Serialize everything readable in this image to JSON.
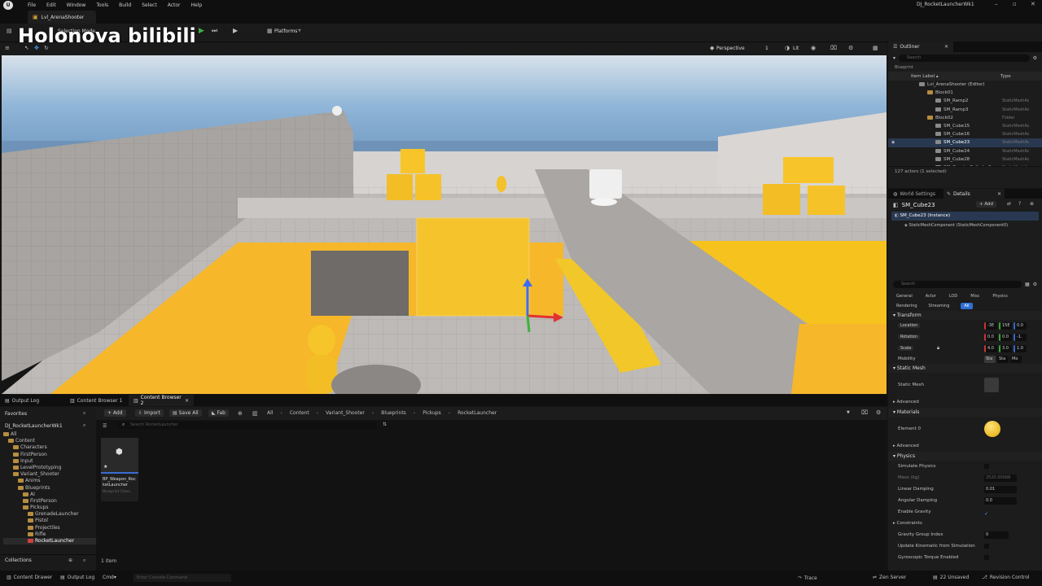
{
  "menu": {
    "items": [
      "File",
      "Edit",
      "Window",
      "Tools",
      "Build",
      "Select",
      "Actor",
      "Help"
    ],
    "title": "DJ_RocketLauncherWk1"
  },
  "tab": {
    "label": "Lvl_ArenaShooter"
  },
  "watermark": {
    "text": "Holonova bilibili"
  },
  "toolbar": {
    "mode": "Selection Mode",
    "platforms": "Platforms"
  },
  "viewport": {
    "perspective": "Perspective",
    "lit": "Lit",
    "camspeed": "1"
  },
  "outliner": {
    "title": "Outliner",
    "search": "Search",
    "blueprint": "Blueprint",
    "col_label": "Item Label ▴",
    "col_type": "Type",
    "rows": [
      {
        "name": "Lvl_ArenaShooter (Editor)",
        "type": "",
        "indent": 0,
        "folder": false
      },
      {
        "name": "Block01",
        "type": "",
        "indent": 1,
        "folder": true
      },
      {
        "name": "SM_Ramp2",
        "type": "StaticMeshAc",
        "indent": 2,
        "folder": false
      },
      {
        "name": "SM_Ramp3",
        "type": "StaticMeshAc",
        "indent": 2,
        "folder": false
      },
      {
        "name": "Block02",
        "type": "Folder",
        "indent": 1,
        "folder": true
      },
      {
        "name": "SM_Cube15",
        "type": "StaticMeshAc",
        "indent": 2,
        "folder": false
      },
      {
        "name": "SM_Cube16",
        "type": "StaticMeshAc",
        "indent": 2,
        "folder": false
      },
      {
        "name": "SM_Cube23",
        "type": "StaticMeshAc",
        "indent": 2,
        "folder": false,
        "selected": true
      },
      {
        "name": "SM_Cube24",
        "type": "StaticMeshAc",
        "indent": 2,
        "folder": false
      },
      {
        "name": "SM_Cube28",
        "type": "StaticMeshAc",
        "indent": 2,
        "folder": false
      },
      {
        "name": "SM_QuarterCylinder0",
        "type": "StaticMeshAc",
        "indent": 2,
        "folder": false
      }
    ],
    "count": "127 actors (1 selected)"
  },
  "details": {
    "tab_world": "World Settings",
    "tab_details": "Details",
    "actor": "SM_Cube23",
    "add": "+ Add",
    "instance": "SM_Cube23 (Instance)",
    "component": "StaticMeshComponent (StaticMeshComponent0)",
    "search": "Search",
    "filters": [
      "General",
      "Actor",
      "LOD",
      "Misc",
      "Physics"
    ],
    "filters2": [
      "Rendering",
      "Streaming",
      "All"
    ],
    "transform": "Transform",
    "location": "Location",
    "rotation": "Rotation",
    "scale": "Scale",
    "mobility": "Mobility",
    "loc": [
      "-3E",
      "15E",
      "0.0"
    ],
    "rot": [
      "0.0",
      "0.0",
      "-1."
    ],
    "scl": [
      "4.0",
      "3.0",
      "1.0"
    ],
    "mob": [
      "Sta",
      "Sta",
      "Mo"
    ],
    "static_mesh_sect": "Static Mesh",
    "static_mesh": "Static Mesh",
    "advanced": "Advanced",
    "materials": "Materials",
    "element0": "Element 0",
    "advanced2": "Advanced",
    "physics": "Physics",
    "simulate": "Simulate Physics",
    "mass": "Mass (kg)",
    "mass_val": "2520.00068",
    "lin_damp": "Linear Damping",
    "lin_val": "0.01",
    "ang_damp": "Angular Damping",
    "ang_val": "0.0",
    "gravity": "Enable Gravity",
    "constraints": "Constraints",
    "grav_group": "Gravity Group Index",
    "grav_val": "0",
    "kin": "Update Kinematic from Simulation",
    "gyro": "Gyroscopic Torque Enabled"
  },
  "cb": {
    "tabs": [
      "Output Log",
      "Content Browser 1",
      "Content Browser 2"
    ],
    "add": "+ Add",
    "import": "Import",
    "save": "Save All",
    "fab": "Fab",
    "path": [
      "All",
      "Content",
      "Variant_Shooter",
      "Blueprints",
      "Pickups",
      "RocketLauncher"
    ],
    "search": "Search RocketLauncher",
    "favorites": "Favorites",
    "project": "DJ_RocketLauncherWk1",
    "tree": [
      {
        "name": "All",
        "indent": 0
      },
      {
        "name": "Content",
        "indent": 1
      },
      {
        "name": "Characters",
        "indent": 2
      },
      {
        "name": "FirstPerson",
        "indent": 2
      },
      {
        "name": "Input",
        "indent": 2
      },
      {
        "name": "LevelPrototyping",
        "indent": 2
      },
      {
        "name": "Variant_Shooter",
        "indent": 2
      },
      {
        "name": "Anims",
        "indent": 3
      },
      {
        "name": "Blueprints",
        "indent": 3
      },
      {
        "name": "AI",
        "indent": 4
      },
      {
        "name": "FirstPerson",
        "indent": 4
      },
      {
        "name": "Pickups",
        "indent": 4
      },
      {
        "name": "GrenadeLauncher",
        "indent": 5
      },
      {
        "name": "Pistol",
        "indent": 5
      },
      {
        "name": "Projectiles",
        "indent": 5
      },
      {
        "name": "Rifle",
        "indent": 5
      },
      {
        "name": "RocketLauncher",
        "indent": 5,
        "selected": true
      }
    ],
    "collections": "Collections",
    "asset_name": "BP_Weapon_RocketLauncher",
    "asset_type": "Blueprint Class",
    "count": "1 item"
  },
  "status": {
    "drawer": "Content Drawer",
    "output": "Output Log",
    "cmd": "Cmd",
    "console": "Enter Console Command",
    "trace": "Trace",
    "zen": "Zen Server",
    "unsaved": "22 Unsaved",
    "rev": "Revision Control"
  }
}
